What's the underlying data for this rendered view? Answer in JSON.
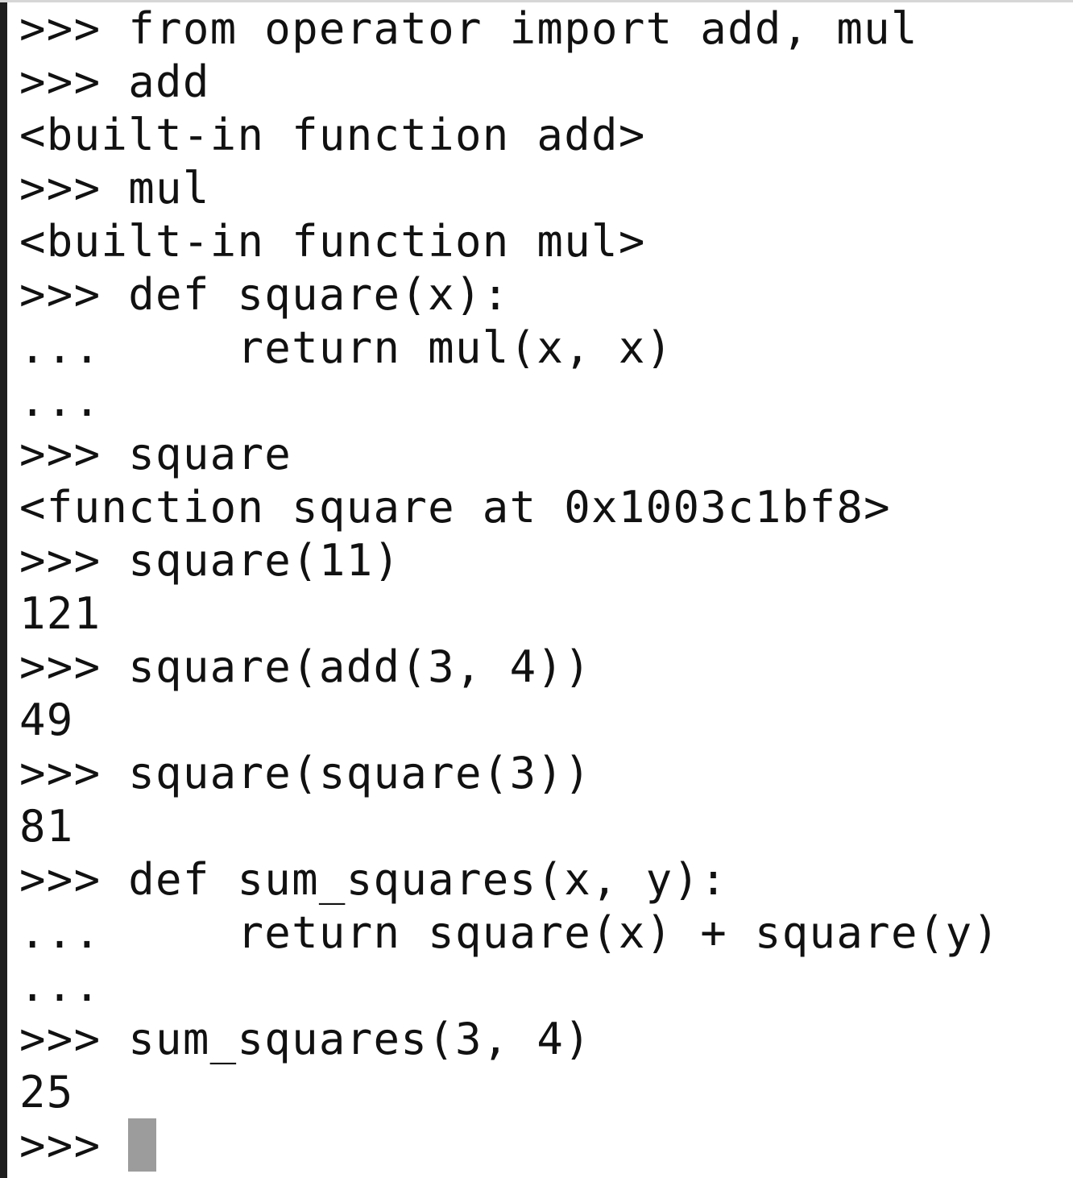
{
  "terminal": {
    "lines": [
      ">>> from operator import add, mul",
      ">>> add",
      "<built-in function add>",
      ">>> mul",
      "<built-in function mul>",
      ">>> def square(x):",
      "...     return mul(x, x)",
      "...",
      ">>> square",
      "<function square at 0x1003c1bf8>",
      ">>> square(11)",
      "121",
      ">>> square(add(3, 4))",
      "49",
      ">>> square(square(3))",
      "81",
      ">>> def sum_squares(x, y):",
      "...     return square(x) + square(y)",
      "...",
      ">>> sum_squares(3, 4)",
      "25",
      ">>>"
    ],
    "colors": {
      "background": "#ffffff",
      "text": "#111111",
      "cursor": "#9c9c9c"
    }
  }
}
